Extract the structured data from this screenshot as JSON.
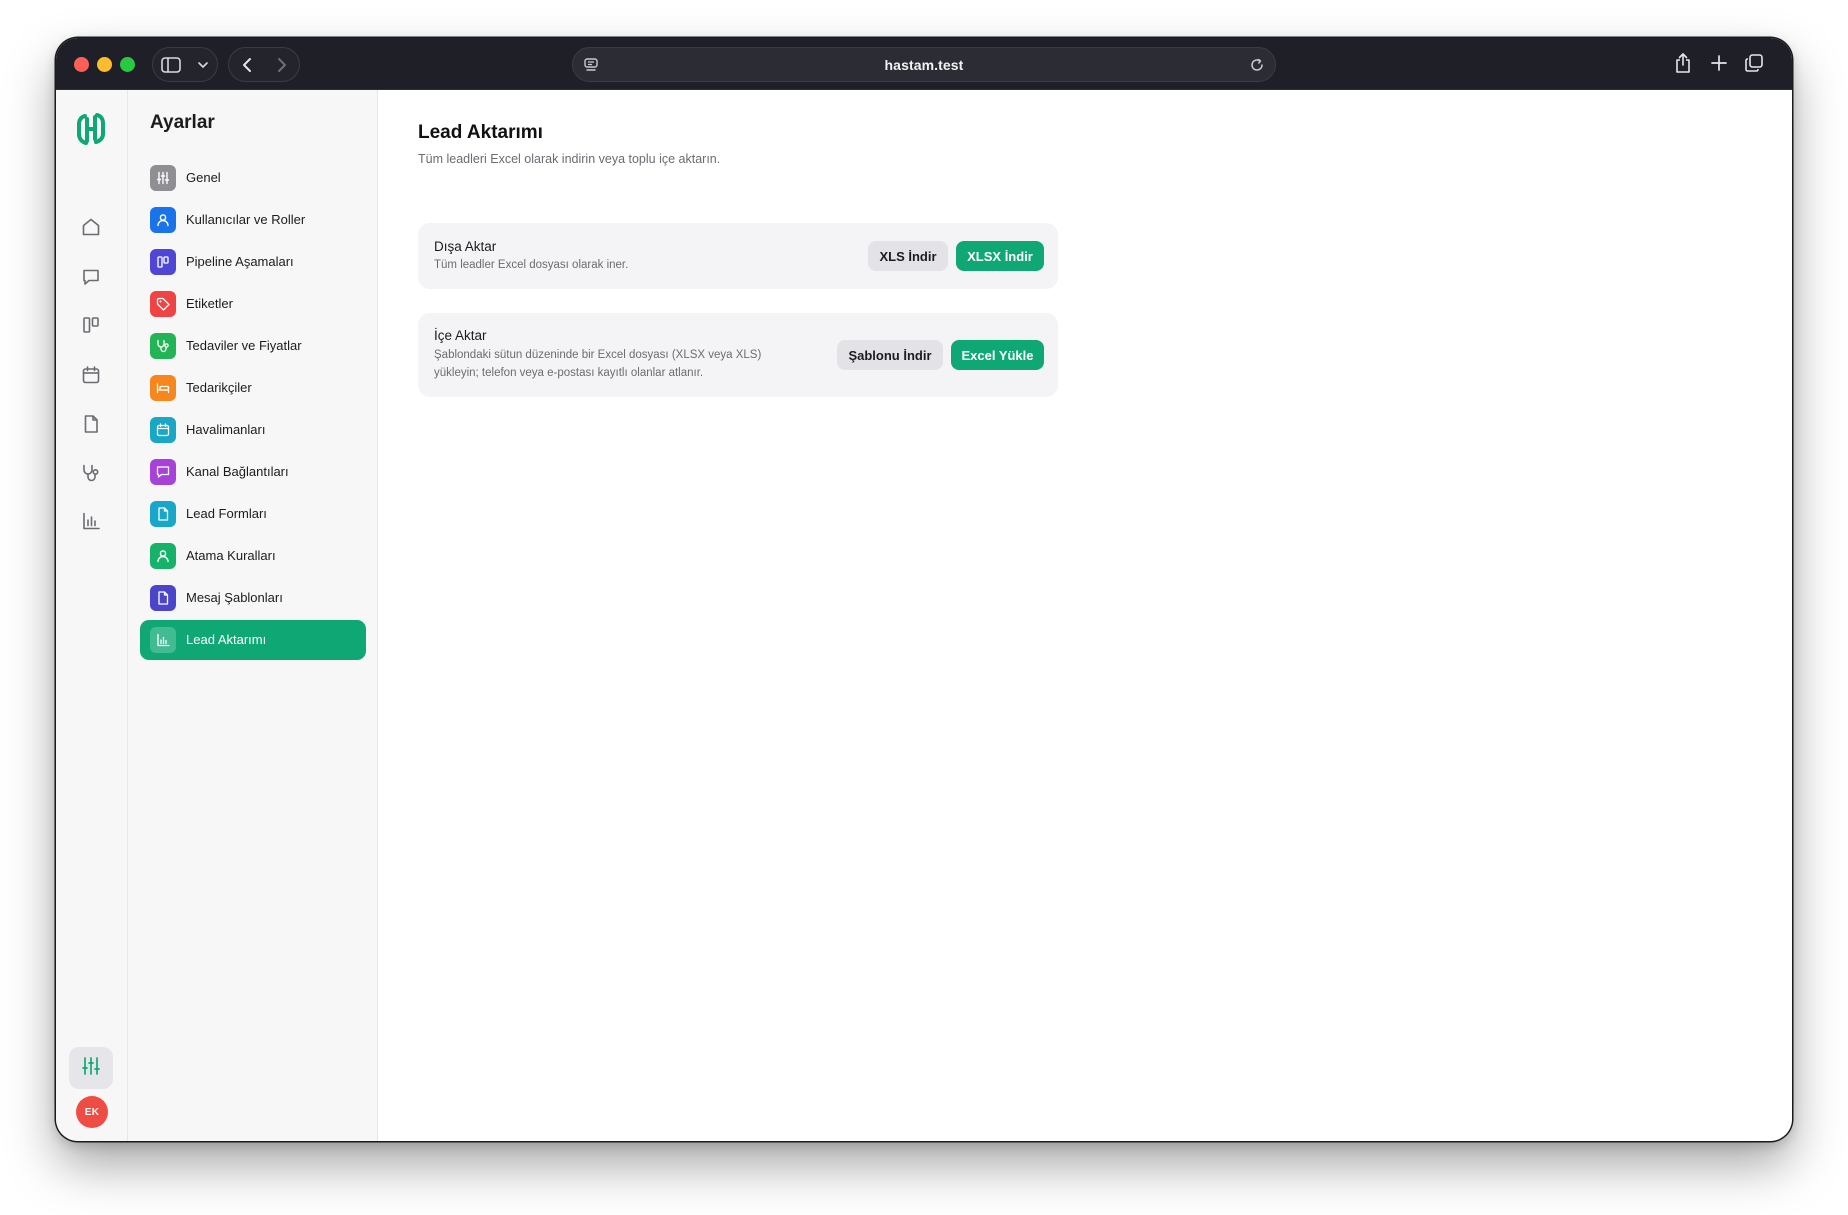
{
  "browser": {
    "url": "hastam.test"
  },
  "rail": {
    "items": [
      {
        "icon": "home-icon"
      },
      {
        "icon": "chat-icon"
      },
      {
        "icon": "pipeline-icon"
      },
      {
        "icon": "calendar-icon"
      },
      {
        "icon": "document-icon"
      },
      {
        "icon": "stethoscope-icon"
      },
      {
        "icon": "chart-icon"
      }
    ],
    "settings_icon": "sliders-icon",
    "avatar_initials": "EK"
  },
  "sidebar": {
    "title": "Ayarlar",
    "items": [
      {
        "label": "Genel",
        "icon": "sliders-icon",
        "color": "#8e8e93"
      },
      {
        "label": "Kullanıcılar ve Roller",
        "icon": "user-icon",
        "color": "#1a73e8"
      },
      {
        "label": "Pipeline Aşamaları",
        "icon": "pipeline-icon",
        "color": "#5046d6"
      },
      {
        "label": "Etiketler",
        "icon": "tag-icon",
        "color": "#ef4444"
      },
      {
        "label": "Tedaviler ve Fiyatlar",
        "icon": "stethoscope-icon",
        "color": "#22b455"
      },
      {
        "label": "Tedarikçiler",
        "icon": "bed-icon",
        "color": "#f7861c"
      },
      {
        "label": "Havalimanları",
        "icon": "calendar-icon",
        "color": "#1aa6c6"
      },
      {
        "label": "Kanal Bağlantıları",
        "icon": "chat-icon",
        "color": "#a642d8"
      },
      {
        "label": "Lead Formları",
        "icon": "document-icon",
        "color": "#18a7c9"
      },
      {
        "label": "Atama Kuralları",
        "icon": "user-icon",
        "color": "#17b26a"
      },
      {
        "label": "Mesaj Şablonları",
        "icon": "document-icon",
        "color": "#4b45c9"
      },
      {
        "label": "Lead Aktarımı",
        "icon": "chart-icon",
        "color": "#0fa874",
        "active": true
      }
    ]
  },
  "main": {
    "title": "Lead Aktarımı",
    "subtitle": "Tüm leadleri Excel olarak indirin veya toplu içe aktarın.",
    "export_card": {
      "title": "Dışa Aktar",
      "description": "Tüm leadler Excel dosyası olarak iner.",
      "xls_button": "XLS İndir",
      "xlsx_button": "XLSX İndir"
    },
    "import_card": {
      "title": "İçe Aktar",
      "description_line1": "Şablondaki sütun düzeninde bir Excel dosyası (XLSX veya XLS)",
      "description_line2": "yükleyin; telefon veya e-postası kayıtlı olanlar atlanır.",
      "template_button": "Şablonu İndir",
      "upload_button": "Excel Yükle"
    }
  },
  "colors": {
    "accent": "#0fa874",
    "chrome": "#1f2027"
  }
}
